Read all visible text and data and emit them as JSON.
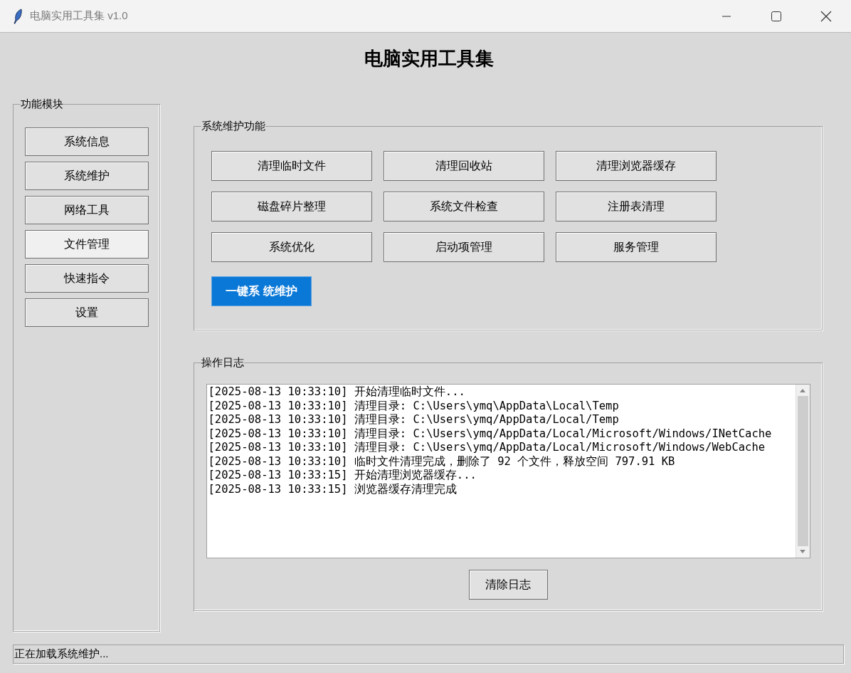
{
  "window": {
    "title": "电脑实用工具集 v1.0"
  },
  "heading": "电脑实用工具集",
  "sidebar": {
    "title": "功能模块",
    "items": [
      {
        "label": "系统信息",
        "selected": false
      },
      {
        "label": "系统维护",
        "selected": false
      },
      {
        "label": "网络工具",
        "selected": false
      },
      {
        "label": "文件管理",
        "selected": true
      },
      {
        "label": "快速指令",
        "selected": false
      },
      {
        "label": "设置",
        "selected": false
      }
    ]
  },
  "maintenance": {
    "title": "系统维护功能",
    "buttons": [
      {
        "label": "清理临时文件",
        "kind": "normal"
      },
      {
        "label": "清理回收站",
        "kind": "normal"
      },
      {
        "label": "清理浏览器缓存",
        "kind": "normal"
      },
      {
        "label": "磁盘碎片整理",
        "kind": "normal"
      },
      {
        "label": "系统文件检查",
        "kind": "normal"
      },
      {
        "label": "注册表清理",
        "kind": "normal"
      },
      {
        "label": "系统优化",
        "kind": "normal"
      },
      {
        "label": "启动项管理",
        "kind": "normal"
      },
      {
        "label": "服务管理",
        "kind": "normal"
      },
      {
        "label": "一键系 统维护",
        "kind": "primary"
      }
    ]
  },
  "log": {
    "title": "操作日志",
    "lines": [
      "[2025-08-13 10:33:10] 开始清理临时文件...",
      "[2025-08-13 10:33:10] 清理目录: C:\\Users\\ymq\\AppData\\Local\\Temp",
      "[2025-08-13 10:33:10] 清理目录: C:\\Users\\ymq/AppData/Local/Temp",
      "[2025-08-13 10:33:10] 清理目录: C:\\Users\\ymq/AppData/Local/Microsoft/Windows/INetCache",
      "[2025-08-13 10:33:10] 清理目录: C:\\Users\\ymq/AppData/Local/Microsoft/Windows/WebCache",
      "[2025-08-13 10:33:10] 临时文件清理完成，删除了 92 个文件，释放空间 797.91 KB",
      "[2025-08-13 10:33:15] 开始清理浏览器缓存...",
      "[2025-08-13 10:33:15] 浏览器缓存清理完成"
    ],
    "clear_button": "清除日志"
  },
  "status_bar": "正在加载系统维护..."
}
